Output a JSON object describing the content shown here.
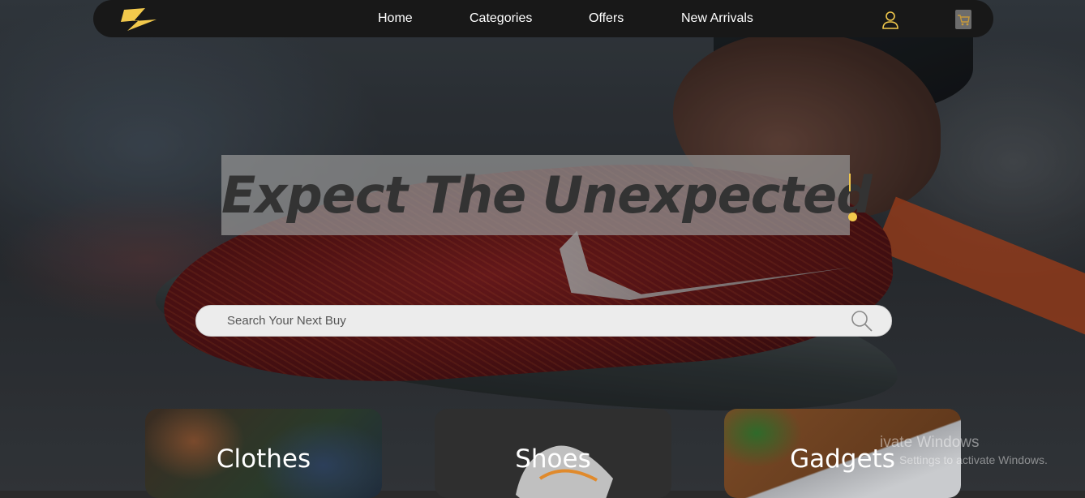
{
  "nav": {
    "links": [
      "Home",
      "Categories",
      "Offers",
      "New Arrivals"
    ],
    "icons": {
      "logo": "lightning-z-logo",
      "user": "user-icon",
      "cart": "cart-icon"
    }
  },
  "hero": {
    "headline": "Expect The Unexpected",
    "accent_color": "#f2c94c"
  },
  "search": {
    "placeholder": "Search Your Next Buy",
    "icon": "search-icon"
  },
  "categories": [
    "Clothes",
    "Shoes",
    "Gadgets"
  ],
  "watermark": {
    "title": "ivate Windows",
    "subtitle": "Settings to activate Windows."
  }
}
